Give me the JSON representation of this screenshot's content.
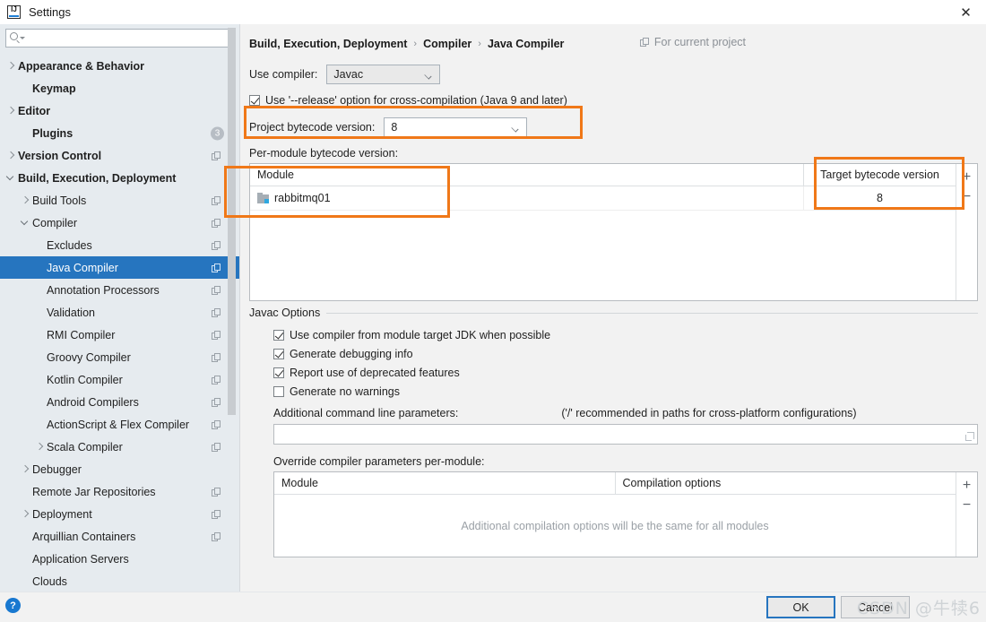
{
  "window": {
    "title": "Settings",
    "logo_icon": "intellij-idea-logo",
    "close_icon": "close-icon"
  },
  "sidebar": {
    "search": {
      "value": "",
      "placeholder": "",
      "icon": "search-icon"
    },
    "items": [
      {
        "label": "Appearance & Behavior",
        "arrow": "right",
        "bold": true,
        "indent": 0,
        "copy": false,
        "badge": ""
      },
      {
        "label": "Keymap",
        "arrow": "none",
        "bold": true,
        "indent": 1,
        "copy": false,
        "badge": ""
      },
      {
        "label": "Editor",
        "arrow": "right",
        "bold": true,
        "indent": 0,
        "copy": false,
        "badge": ""
      },
      {
        "label": "Plugins",
        "arrow": "none",
        "bold": true,
        "indent": 1,
        "copy": false,
        "badge": "3"
      },
      {
        "label": "Version Control",
        "arrow": "right",
        "bold": true,
        "indent": 0,
        "copy": true,
        "badge": ""
      },
      {
        "label": "Build, Execution, Deployment",
        "arrow": "down",
        "bold": true,
        "indent": 0,
        "copy": false,
        "badge": ""
      },
      {
        "label": "Build Tools",
        "arrow": "right",
        "bold": false,
        "indent": 1,
        "copy": true,
        "badge": ""
      },
      {
        "label": "Compiler",
        "arrow": "down",
        "bold": false,
        "indent": 1,
        "copy": true,
        "badge": ""
      },
      {
        "label": "Excludes",
        "arrow": "none",
        "bold": false,
        "indent": 2,
        "copy": true,
        "badge": ""
      },
      {
        "label": "Java Compiler",
        "arrow": "none",
        "bold": false,
        "indent": 2,
        "copy": true,
        "badge": "",
        "selected": true
      },
      {
        "label": "Annotation Processors",
        "arrow": "none",
        "bold": false,
        "indent": 2,
        "copy": true,
        "badge": ""
      },
      {
        "label": "Validation",
        "arrow": "none",
        "bold": false,
        "indent": 2,
        "copy": true,
        "badge": ""
      },
      {
        "label": "RMI Compiler",
        "arrow": "none",
        "bold": false,
        "indent": 2,
        "copy": true,
        "badge": ""
      },
      {
        "label": "Groovy Compiler",
        "arrow": "none",
        "bold": false,
        "indent": 2,
        "copy": true,
        "badge": ""
      },
      {
        "label": "Kotlin Compiler",
        "arrow": "none",
        "bold": false,
        "indent": 2,
        "copy": true,
        "badge": ""
      },
      {
        "label": "Android Compilers",
        "arrow": "none",
        "bold": false,
        "indent": 2,
        "copy": true,
        "badge": ""
      },
      {
        "label": "ActionScript & Flex Compiler",
        "arrow": "none",
        "bold": false,
        "indent": 2,
        "copy": true,
        "badge": ""
      },
      {
        "label": "Scala Compiler",
        "arrow": "right",
        "bold": false,
        "indent": 2,
        "copy": true,
        "badge": ""
      },
      {
        "label": "Debugger",
        "arrow": "right",
        "bold": false,
        "indent": 1,
        "copy": false,
        "badge": ""
      },
      {
        "label": "Remote Jar Repositories",
        "arrow": "none",
        "bold": false,
        "indent": 1,
        "copy": true,
        "badge": ""
      },
      {
        "label": "Deployment",
        "arrow": "right",
        "bold": false,
        "indent": 1,
        "copy": true,
        "badge": ""
      },
      {
        "label": "Arquillian Containers",
        "arrow": "none",
        "bold": false,
        "indent": 1,
        "copy": true,
        "badge": ""
      },
      {
        "label": "Application Servers",
        "arrow": "none",
        "bold": false,
        "indent": 1,
        "copy": false,
        "badge": ""
      },
      {
        "label": "Clouds",
        "arrow": "none",
        "bold": false,
        "indent": 1,
        "copy": false,
        "badge": ""
      }
    ]
  },
  "main": {
    "breadcrumb": [
      "Build, Execution, Deployment",
      "Compiler",
      "Java Compiler"
    ],
    "breadcrumb_sep": "›",
    "for_current_project": "For current project",
    "use_compiler_label": "Use compiler:",
    "use_compiler_value": "Javac",
    "release_option_label": "Use '--release' option for cross-compilation (Java 9 and later)",
    "release_option_checked": true,
    "project_bytecode_label": "Project bytecode version:",
    "project_bytecode_value": "8",
    "per_module_label": "Per-module bytecode version:",
    "module_table": {
      "columns": [
        "Module",
        "Target bytecode version"
      ],
      "rows": [
        {
          "module": "rabbitmq01",
          "target": "8"
        }
      ],
      "add_label": "+",
      "remove_label": "−"
    },
    "javac_group_title": "Javac Options",
    "javac_options": [
      {
        "label": "Use compiler from module target JDK when possible",
        "checked": true
      },
      {
        "label": "Generate debugging info",
        "checked": true
      },
      {
        "label": "Report use of deprecated features",
        "checked": true
      },
      {
        "label": "Generate no warnings",
        "checked": false
      }
    ],
    "additional_params_label": "Additional command line parameters:",
    "additional_params_hint": "('/' recommended in paths for cross-platform configurations)",
    "additional_params_value": "",
    "override_label": "Override compiler parameters per-module:",
    "override_table": {
      "columns": [
        "Module",
        "Compilation options"
      ],
      "empty_message": "Additional compilation options will be the same for all modules",
      "add_label": "+",
      "remove_label": "−"
    }
  },
  "footer": {
    "help_label": "?",
    "ok_label": "OK",
    "cancel_label": "Cancel",
    "watermark": "CSDN @牛犊6"
  },
  "colors": {
    "accent": "#2675bf",
    "annotation": "#f07818",
    "sidebar_bg": "#e6ebef",
    "panel_bg": "#f2f2f2"
  }
}
